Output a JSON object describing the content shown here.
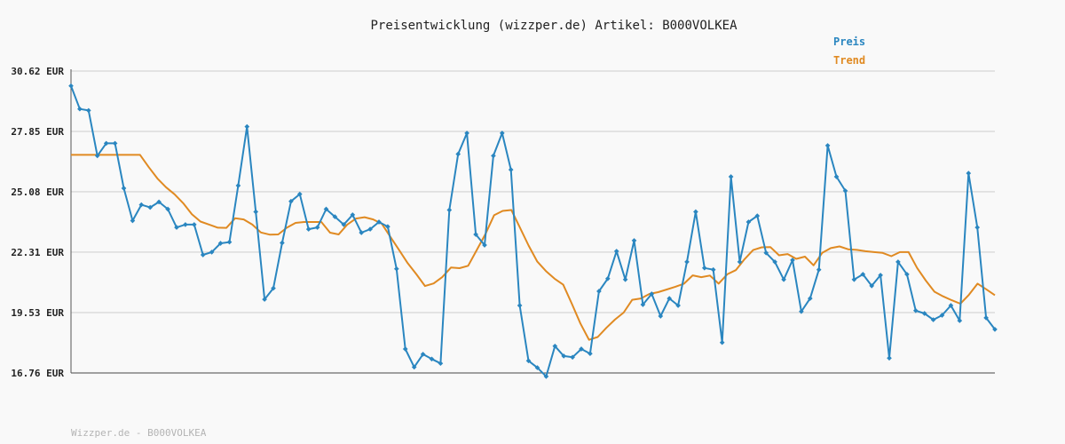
{
  "chart_data": {
    "type": "line",
    "title": "Preisentwicklung (wizzper.de) Artikel: B000VOLKEA",
    "xlabel": "",
    "ylabel": "",
    "ylim": [
      16.76,
      30.62
    ],
    "y_ticks": [
      "30.62 EUR",
      "27.85 EUR",
      "25.08 EUR",
      "22.31 EUR",
      "19.53 EUR",
      "16.76 EUR"
    ],
    "y_tick_values": [
      30.62,
      27.85,
      25.08,
      22.31,
      19.53,
      16.76
    ],
    "grid": true,
    "legend_position": "top-right",
    "series": [
      {
        "name": "Preis",
        "color": "#2a86c0",
        "values": [
          29.94,
          28.88,
          28.81,
          26.73,
          27.3,
          27.3,
          25.24,
          23.75,
          24.48,
          24.36,
          24.61,
          24.28,
          23.44,
          23.57,
          23.57,
          22.18,
          22.31,
          22.71,
          22.77,
          25.36,
          28.07,
          24.16,
          20.14,
          20.65,
          22.73,
          24.64,
          24.97,
          23.36,
          23.44,
          24.28,
          23.93,
          23.57,
          24.02,
          23.2,
          23.36,
          23.69,
          23.48,
          21.54,
          17.86,
          17.03,
          17.62,
          17.4,
          17.2,
          24.24,
          26.81,
          27.77,
          23.12,
          22.63,
          26.73,
          27.77,
          26.09,
          19.86,
          17.32,
          17.0,
          16.6,
          17.99,
          17.54,
          17.48,
          17.86,
          17.65,
          20.51,
          21.09,
          22.35,
          21.05,
          22.84,
          19.9,
          20.39,
          19.37,
          20.18,
          19.86,
          21.86,
          24.16,
          21.58,
          21.5,
          18.16,
          25.77,
          21.86,
          23.69,
          23.97,
          22.27,
          21.86,
          21.05,
          21.94,
          19.58,
          20.18,
          21.5,
          27.2,
          25.77,
          25.12,
          21.05,
          21.29,
          20.76,
          21.25,
          17.44,
          21.86,
          21.29,
          19.62,
          19.49,
          19.2,
          19.41,
          19.86,
          19.16,
          25.93,
          23.44,
          19.29,
          18.76
        ],
        "markers": true
      },
      {
        "name": "Trend",
        "color": "#e08a22",
        "values": [
          26.77,
          26.77,
          26.77,
          26.77,
          26.77,
          26.77,
          26.77,
          26.77,
          26.77,
          26.21,
          25.69,
          25.29,
          24.96,
          24.55,
          24.05,
          23.71,
          23.57,
          23.43,
          23.42,
          23.86,
          23.81,
          23.57,
          23.21,
          23.11,
          23.12,
          23.43,
          23.65,
          23.69,
          23.69,
          23.69,
          23.2,
          23.12,
          23.57,
          23.85,
          23.91,
          23.81,
          23.61,
          23.0,
          22.4,
          21.8,
          21.29,
          20.75,
          20.87,
          21.16,
          21.6,
          21.57,
          21.68,
          22.41,
          23.14,
          24.0,
          24.2,
          24.24,
          23.43,
          22.61,
          21.87,
          21.44,
          21.09,
          20.81,
          19.94,
          19.03,
          18.28,
          18.41,
          18.83,
          19.21,
          19.53,
          20.12,
          20.18,
          20.39,
          20.47,
          20.59,
          20.72,
          20.86,
          21.24,
          21.16,
          21.23,
          20.86,
          21.29,
          21.48,
          21.98,
          22.4,
          22.53,
          22.54,
          22.16,
          22.22,
          22.0,
          22.1,
          21.7,
          22.27,
          22.49,
          22.57,
          22.44,
          22.41,
          22.35,
          22.31,
          22.27,
          22.12,
          22.31,
          22.31,
          21.58,
          21.0,
          20.49,
          20.28,
          20.1,
          19.94,
          20.35,
          20.86,
          20.6,
          20.33
        ]
      }
    ]
  },
  "footer_text": "Wizzper.de - B000VOLKEA"
}
